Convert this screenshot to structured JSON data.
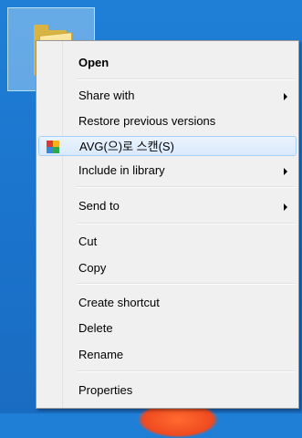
{
  "desktop": {
    "selected_icon": "folder-icon"
  },
  "menu": {
    "items": [
      {
        "label": "Open"
      },
      {
        "label": "Share with"
      },
      {
        "label": "Restore previous versions"
      },
      {
        "label": "AVG(으)로 스캔(S)",
        "icon": "avg-icon"
      },
      {
        "label": "Include in library"
      },
      {
        "label": "Send to"
      },
      {
        "label": "Cut"
      },
      {
        "label": "Copy"
      },
      {
        "label": "Create shortcut"
      },
      {
        "label": "Delete"
      },
      {
        "label": "Rename"
      },
      {
        "label": "Properties"
      }
    ]
  },
  "colors": {
    "desktop_background": "#1f7fd6",
    "menu_background": "#f0f0f0",
    "hover_border": "#a8cff5"
  }
}
